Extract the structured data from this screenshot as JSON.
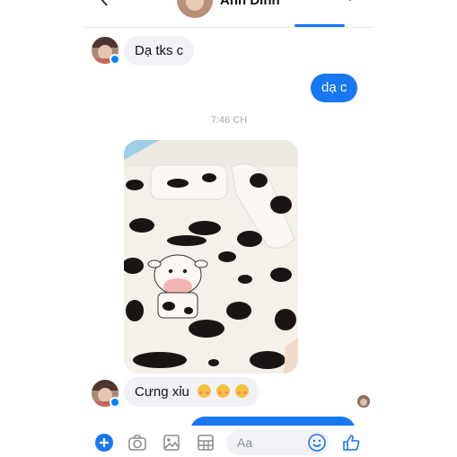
{
  "header": {
    "contact_name": "Anh Dinh"
  },
  "messages": [
    {
      "sender": "contact",
      "text": "Dạ tks c"
    },
    {
      "sender": "me",
      "text": "dạ c"
    },
    {
      "type": "timestamp",
      "text": "7:46 CH"
    },
    {
      "sender": "contact",
      "type": "photo",
      "description": "cow print bedding photo"
    },
    {
      "sender": "contact",
      "text": "Cưng xỉu",
      "emojis": [
        "smiling-face-with-hearts",
        "smiling-face-with-hearts",
        "smiling-face-with-hearts"
      ]
    }
  ],
  "composer": {
    "placeholder": "Aa",
    "icons": [
      "plus-icon",
      "camera-icon",
      "gallery-icon",
      "sticker-icon",
      "emoji-icon",
      "like-icon"
    ]
  },
  "colors": {
    "accent": "#1877f2",
    "incoming_bubble": "#f0f2f5"
  }
}
